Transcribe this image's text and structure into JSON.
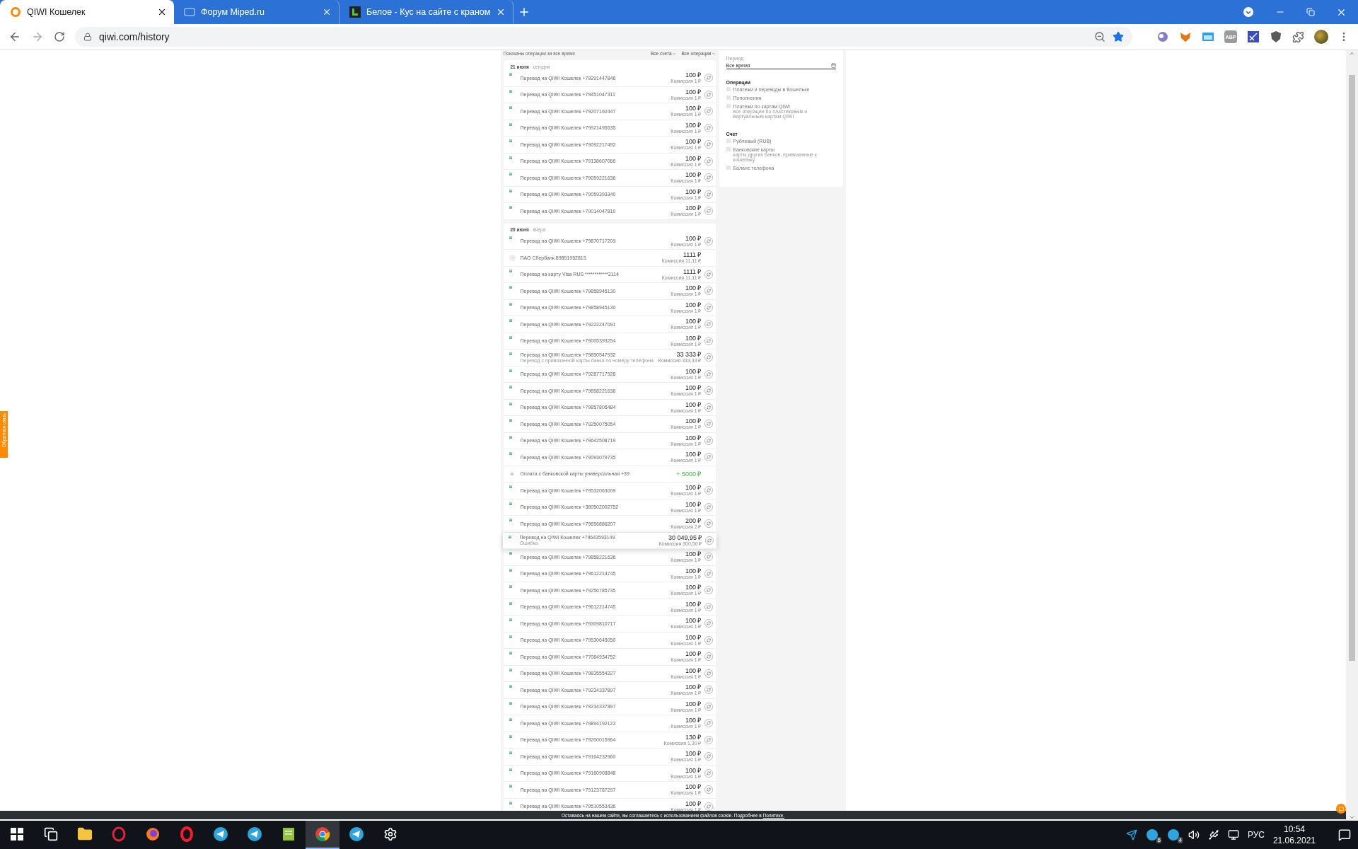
{
  "browser": {
    "tabs": [
      {
        "kind": "qiwi",
        "title": "QIWI Кошелек",
        "selected": true
      },
      {
        "kind": "forum",
        "title": "Форум Miped.ru",
        "selected": false
      },
      {
        "kind": "site",
        "title": "Белое - Кус на сайте с краном",
        "selected": false
      }
    ],
    "address": "qiwi.com/history",
    "extensions": [
      {
        "kind": "orb"
      },
      {
        "kind": "fox"
      },
      {
        "kind": "window"
      },
      {
        "kind": "abp",
        "label": "ABP"
      },
      {
        "kind": "flag"
      },
      {
        "kind": "shield"
      },
      {
        "kind": "puzzle"
      }
    ]
  },
  "page": {
    "top_line": {
      "left": "Показаны операции за все время",
      "right": [
        "Все счета",
        "Все операции"
      ]
    },
    "days": [
      {
        "date": "21 июня",
        "note": "сегодня",
        "rows": [
          {
            "kind": "transfer",
            "title": "Перевод на QIWI Кошелек +79291447846",
            "amount": "100 ₽",
            "fee": "Комиссия 1 ₽",
            "positive": false,
            "repeat": true,
            "highlighted": false
          },
          {
            "kind": "transfer",
            "title": "Перевод на QIWI Кошелек +79451047311",
            "amount": "100 ₽",
            "fee": "Комиссия 1 ₽",
            "positive": false,
            "repeat": true,
            "highlighted": false
          },
          {
            "kind": "transfer",
            "title": "Перевод на QIWI Кошелек +79207192447",
            "amount": "100 ₽",
            "fee": "Комиссия 1 ₽",
            "positive": false,
            "repeat": true,
            "highlighted": false
          },
          {
            "kind": "transfer",
            "title": "Перевод на QIWI Кошелек +79921495535",
            "amount": "100 ₽",
            "fee": "Комиссия 1 ₽",
            "positive": false,
            "repeat": true,
            "highlighted": false
          },
          {
            "kind": "transfer",
            "title": "Перевод на QIWI Кошелек +79092217492",
            "amount": "100 ₽",
            "fee": "Комиссия 1 ₽",
            "positive": false,
            "repeat": true,
            "highlighted": false
          },
          {
            "kind": "transfer",
            "title": "Перевод на QIWI Кошелек +79138607066",
            "amount": "100 ₽",
            "fee": "Комиссия 1 ₽",
            "positive": false,
            "repeat": true,
            "highlighted": false
          },
          {
            "kind": "transfer",
            "title": "Перевод на QIWI Кошелек +79059221636",
            "amount": "100 ₽",
            "fee": "Комиссия 1 ₽",
            "positive": false,
            "repeat": true,
            "highlighted": false
          },
          {
            "kind": "transfer",
            "title": "Перевод на QIWI Кошелек +79059393340",
            "amount": "100 ₽",
            "fee": "Комиссия 1 ₽",
            "positive": false,
            "repeat": true,
            "highlighted": false
          },
          {
            "kind": "transfer",
            "title": "Перевод на QIWI Кошелек +79014047810",
            "amount": "100 ₽",
            "fee": "Комиссия 1 ₽",
            "positive": false,
            "repeat": true,
            "highlighted": false
          }
        ]
      },
      {
        "date": "20 июня",
        "note": "вчера",
        "rows": [
          {
            "kind": "transfer",
            "title": "Перевод на QIWI Кошелек +79870717209",
            "amount": "100 ₽",
            "fee": "Комиссия 1 ₽",
            "positive": false,
            "repeat": true,
            "highlighted": false
          },
          {
            "kind": "bank",
            "title": "ПАО Сбербанк 89851952815",
            "amount": "1111 ₽",
            "fee": "Комиссия 11,11 ₽",
            "positive": false,
            "repeat": false,
            "highlighted": false
          },
          {
            "kind": "transfer",
            "title": "Перевод на карту Visa RUS ************3114",
            "amount": "1111 ₽",
            "fee": "Комиссия 11,11 ₽",
            "positive": false,
            "repeat": true,
            "highlighted": false
          },
          {
            "kind": "transfer",
            "title": "Перевод на QIWI Кошелек +79858945130",
            "amount": "100 ₽",
            "fee": "Комиссия 1 ₽",
            "positive": false,
            "repeat": true,
            "highlighted": false
          },
          {
            "kind": "transfer",
            "title": "Перевод на QIWI Кошелек +79858945130",
            "amount": "100 ₽",
            "fee": "Комиссия 1 ₽",
            "positive": false,
            "repeat": true,
            "highlighted": false
          },
          {
            "kind": "transfer",
            "title": "Перевод на QIWI Кошелек +79222247091",
            "amount": "100 ₽",
            "fee": "Комиссия 1 ₽",
            "positive": false,
            "repeat": true,
            "highlighted": false
          },
          {
            "kind": "transfer",
            "title": "Перевод на QIWI Кошелек +79005393254",
            "amount": "100 ₽",
            "fee": "Комиссия 1 ₽",
            "positive": false,
            "repeat": true,
            "highlighted": false
          },
          {
            "kind": "transfer",
            "title": "Перевод на QIWI Кошелек +79850547932",
            "note": "Перевод с привязанной карты банка по номеру телефона",
            "amount": "33 333 ₽",
            "fee": "Комиссия 333,33 ₽",
            "positive": false,
            "repeat": true,
            "highlighted": false
          },
          {
            "kind": "transfer",
            "title": "Перевод на QIWI Кошелек +79287717928",
            "amount": "100 ₽",
            "fee": "Комиссия 1 ₽",
            "positive": false,
            "repeat": true,
            "highlighted": false
          },
          {
            "kind": "transfer",
            "title": "Перевод на QIWI Кошелек +79858221636",
            "amount": "100 ₽",
            "fee": "Комиссия 1 ₽",
            "positive": false,
            "repeat": true,
            "highlighted": false
          },
          {
            "kind": "transfer",
            "title": "Перевод на QIWI Кошелек +79857805484",
            "amount": "100 ₽",
            "fee": "Комиссия 1 ₽",
            "positive": false,
            "repeat": true,
            "highlighted": false
          },
          {
            "kind": "transfer",
            "title": "Перевод на QIWI Кошелек +79250075054",
            "amount": "100 ₽",
            "fee": "Комиссия 1 ₽",
            "positive": false,
            "repeat": true,
            "highlighted": false
          },
          {
            "kind": "transfer",
            "title": "Перевод на QIWI Кошелек +79642508719",
            "amount": "100 ₽",
            "fee": "Комиссия 1 ₽",
            "positive": false,
            "repeat": true,
            "highlighted": false
          },
          {
            "kind": "transfer",
            "title": "Перевод на QIWI Кошелек +79093079735",
            "amount": "100 ₽",
            "fee": "Комиссия 1 ₽",
            "positive": false,
            "repeat": true,
            "highlighted": false
          },
          {
            "kind": "topup",
            "title": "Оплата с банковской карты универсальная +39",
            "amount": "+ 5000 ₽",
            "positive": true,
            "repeat": false,
            "highlighted": false
          },
          {
            "kind": "transfer",
            "title": "Перевод на QIWI Кошелек +79532063009",
            "amount": "100 ₽",
            "fee": "Комиссия 1 ₽",
            "positive": false,
            "repeat": true,
            "highlighted": false
          },
          {
            "kind": "transfer",
            "title": "Перевод на QIWI Кошелек +380502002752",
            "amount": "100 ₽",
            "fee": "Комиссия 1 ₽",
            "positive": false,
            "repeat": true,
            "highlighted": false
          },
          {
            "kind": "transfer",
            "title": "Перевод на QIWI Кошелек +79656886207",
            "amount": "200 ₽",
            "fee": "Комиссия 2 ₽",
            "positive": false,
            "repeat": true,
            "highlighted": false
          },
          {
            "kind": "transfer",
            "title": "Перевод на QIWI Кошелек +79643593149",
            "note": "Ошибка",
            "amount": "30 049,95 ₽",
            "fee": "Комиссия 300,50 ₽",
            "positive": false,
            "repeat": true,
            "highlighted": true
          },
          {
            "kind": "transfer",
            "title": "Перевод на QIWI Кошелек +79858221636",
            "amount": "100 ₽",
            "fee": "Комиссия 1 ₽",
            "positive": false,
            "repeat": true,
            "highlighted": false
          },
          {
            "kind": "transfer",
            "title": "Перевод на QIWI Кошелек +79612214745",
            "amount": "100 ₽",
            "fee": "Комиссия 1 ₽",
            "positive": false,
            "repeat": true,
            "highlighted": false
          },
          {
            "kind": "transfer",
            "title": "Перевод на QIWI Кошелек +79256785735",
            "amount": "100 ₽",
            "fee": "Комиссия 1 ₽",
            "positive": false,
            "repeat": true,
            "highlighted": false
          },
          {
            "kind": "transfer",
            "title": "Перевод на QIWI Кошелек +79612214745",
            "amount": "100 ₽",
            "fee": "Комиссия 1 ₽",
            "positive": false,
            "repeat": true,
            "highlighted": false
          },
          {
            "kind": "transfer",
            "title": "Перевод на QIWI Кошелек +79309810717",
            "amount": "100 ₽",
            "fee": "Комиссия 1 ₽",
            "positive": false,
            "repeat": true,
            "highlighted": false
          },
          {
            "kind": "transfer",
            "title": "Перевод на QIWI Кошелек +79530645050",
            "amount": "100 ₽",
            "fee": "Комиссия 1 ₽",
            "positive": false,
            "repeat": true,
            "highlighted": false
          },
          {
            "kind": "transfer",
            "title": "Перевод на QIWI Кошелек +77084934752",
            "amount": "100 ₽",
            "fee": "Комиссия 1 ₽",
            "positive": false,
            "repeat": true,
            "highlighted": false
          },
          {
            "kind": "transfer",
            "title": "Перевод на QIWI Кошелек +79835554227",
            "amount": "100 ₽",
            "fee": "Комиссия 1 ₽",
            "positive": false,
            "repeat": true,
            "highlighted": false
          },
          {
            "kind": "transfer",
            "title": "Перевод на QIWI Кошелек +79234337897",
            "amount": "100 ₽",
            "fee": "Комиссия 1 ₽",
            "positive": false,
            "repeat": true,
            "highlighted": false
          },
          {
            "kind": "transfer",
            "title": "Перевод на QIWI Кошелек +79234337897",
            "amount": "100 ₽",
            "fee": "Комиссия 1 ₽",
            "positive": false,
            "repeat": true,
            "highlighted": false
          },
          {
            "kind": "transfer",
            "title": "Перевод на QIWI Кошелек +79894192123",
            "amount": "100 ₽",
            "fee": "Комиссия 1 ₽",
            "positive": false,
            "repeat": true,
            "highlighted": false
          },
          {
            "kind": "transfer",
            "title": "Перевод на QIWI Кошелек +79200015964",
            "amount": "130 ₽",
            "fee": "Комиссия 1,30 ₽",
            "positive": false,
            "repeat": true,
            "highlighted": false
          },
          {
            "kind": "transfer",
            "title": "Перевод на QIWI Кошелек +79164232960",
            "amount": "100 ₽",
            "fee": "Комиссия 1 ₽",
            "positive": false,
            "repeat": true,
            "highlighted": false
          },
          {
            "kind": "transfer",
            "title": "Перевод на QIWI Кошелек +79160908848",
            "amount": "100 ₽",
            "fee": "Комиссия 1 ₽",
            "positive": false,
            "repeat": true,
            "highlighted": false
          },
          {
            "kind": "transfer",
            "title": "Перевод на QIWI Кошелек +79123787297",
            "amount": "100 ₽",
            "fee": "Комиссия 1 ₽",
            "positive": false,
            "repeat": true,
            "highlighted": false
          },
          {
            "kind": "transfer",
            "title": "Перевод на QIWI Кошелек +79510553436",
            "amount": "100 ₽",
            "fee": "Комиссия 1 ₽",
            "positive": false,
            "repeat": true,
            "highlighted": false
          }
        ]
      }
    ],
    "filters": {
      "period": {
        "label": "Период",
        "value": "Все время"
      },
      "groups": [
        {
          "title": "Операции",
          "options": [
            {
              "label": "Платежи и переводы в Кошельке",
              "checked": false
            },
            {
              "label": "Пополнения",
              "checked": false
            },
            {
              "label": "Платежи по картам QIWI",
              "hint": "все операции по пластиковым и виртуальным картам QIWI",
              "checked": false
            }
          ]
        },
        {
          "title": "Счет",
          "options": [
            {
              "label": "Рублевый (RUB)",
              "checked": false
            },
            {
              "label": "Банковские карты",
              "hint": "карты других банков, привязанные к кошельку",
              "checked": false
            },
            {
              "label": "Баланс телефона",
              "checked": false
            }
          ]
        }
      ]
    },
    "cookie_notice": {
      "text": "Оставаясь на нашем сайте, вы соглашаетесь с использованием файлов cookie. Подробнее в ",
      "link": "Политике."
    },
    "side_tab": "Обратная связь"
  },
  "taskbar": {
    "apps": [
      {
        "kind": "taskview",
        "active": false
      },
      {
        "kind": "explorer",
        "active": false
      },
      {
        "kind": "operagx",
        "active": false
      },
      {
        "kind": "firefox",
        "active": false
      },
      {
        "kind": "opera",
        "active": false
      },
      {
        "kind": "telegram",
        "active": false
      },
      {
        "kind": "telegram",
        "active": false
      },
      {
        "kind": "notepad",
        "active": false
      },
      {
        "kind": "chrome",
        "active": true
      },
      {
        "kind": "telegram",
        "active": false
      },
      {
        "kind": "settings",
        "active": false
      }
    ],
    "tray": {
      "badges": [
        "6",
        "4"
      ],
      "language": "РУС",
      "time": "10:54",
      "date": "21.06.2021"
    }
  }
}
